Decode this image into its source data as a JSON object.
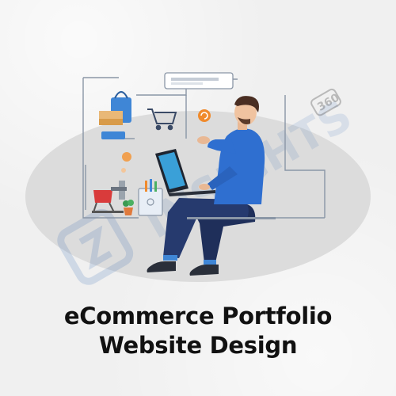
{
  "poster": {
    "title_line1": "eCommerce Portfolio",
    "title_line2": "Website Design"
  },
  "watermark": {
    "brand_text": "INSIGHTS",
    "badge_text": "360"
  },
  "colors": {
    "background": "#f2f2f2",
    "ellipse": "#dcdcdc",
    "shirt": "#2f6fd0",
    "pants": "#1f2f5a",
    "accent_orange": "#f08a2c",
    "line_gray": "#8a96a6",
    "title_text": "#111111"
  },
  "icons": [
    "shopping-bag-icon",
    "shopping-cart-icon",
    "refresh-icon",
    "cash-register-icon",
    "laptop-icon",
    "coin-icon",
    "potted-plant-icon",
    "pen-holder-icon"
  ]
}
